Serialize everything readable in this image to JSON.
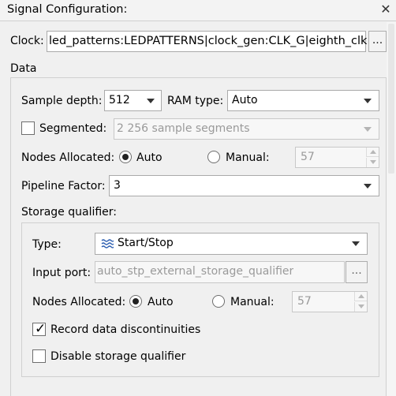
{
  "panel": {
    "title": "Signal Configuration:",
    "close_glyph": "✕"
  },
  "clock": {
    "label": "Clock:",
    "value": "led_patterns:LEDPATTERNS|clock_gen:CLK_G|eighth_clk",
    "browse_label": "..."
  },
  "data_group": {
    "title": "Data",
    "sample_depth": {
      "label": "Sample depth:",
      "value": "512"
    },
    "ram_type": {
      "label": "RAM type:",
      "value": "Auto"
    },
    "segmented": {
      "label": "Segmented:",
      "checked": false,
      "value": "2  256 sample segments"
    },
    "nodes_allocated": {
      "label": "Nodes Allocated:",
      "auto_label": "Auto",
      "manual_label": "Manual:",
      "selected": "Auto",
      "manual_value": "57"
    },
    "pipeline_factor": {
      "label": "Pipeline Factor:",
      "value": "3"
    }
  },
  "storage_qualifier": {
    "title": "Storage qualifier:",
    "type": {
      "label": "Type:",
      "value": "Start/Stop",
      "icon": "start-stop-icon"
    },
    "input_port": {
      "label": "Input port:",
      "value": "auto_stp_external_storage_qualifier",
      "browse_label": "..."
    },
    "nodes_allocated": {
      "label": "Nodes Allocated:",
      "auto_label": "Auto",
      "manual_label": "Manual:",
      "selected": "Auto",
      "manual_value": "57"
    },
    "record_discontinuities": {
      "label": "Record data discontinuities",
      "checked": true,
      "check_glyph": "✓"
    },
    "disable_qualifier": {
      "label": "Disable storage qualifier",
      "checked": false
    }
  }
}
